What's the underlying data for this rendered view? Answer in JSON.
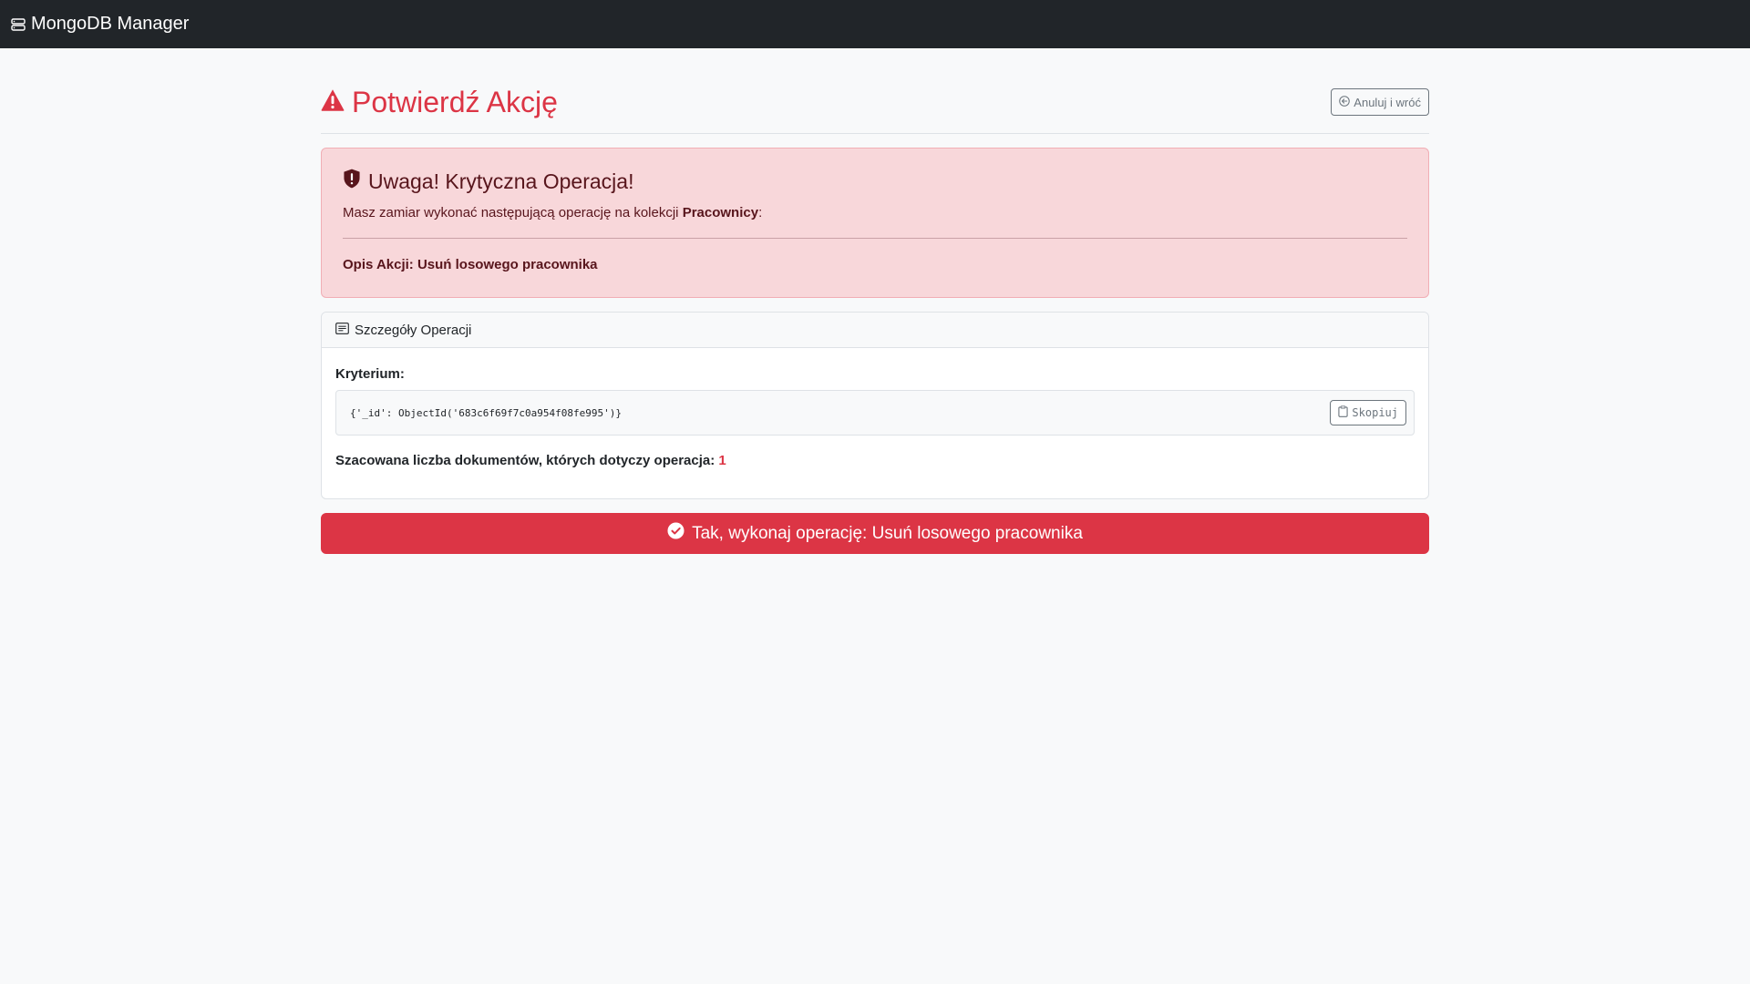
{
  "navbar": {
    "brand_icon": "server-icon",
    "brand_label": "MongoDB Manager"
  },
  "header": {
    "title_icon": "warning-triangle-icon",
    "title": "Potwierdź Akcję",
    "cancel_icon": "arrow-left-circle-icon",
    "cancel_label": "Anuluj i wróć"
  },
  "alert": {
    "icon": "shield-exclamation-icon",
    "heading": "Uwaga! Krytyczna Operacja!",
    "text_prefix": "Masz zamiar wykonać następującą operację na kolekcji ",
    "collection": "Pracownicy",
    "text_suffix": ":",
    "description": "Opis Akcji: Usuń losowego pracownika"
  },
  "details": {
    "header_icon": "card-text-icon",
    "header": "Szczegóły Operacji",
    "criterion_label": "Kryterium:",
    "criterion_value": "{'_id': ObjectId('683c6f69f7c0a954f08fe995')}",
    "copy_icon": "clipboard-icon",
    "copy_label": "Skopiuj",
    "count_label": "Szacowana liczba dokumentów, których dotyczy operacja: ",
    "count_value": "1"
  },
  "confirm": {
    "icon": "check-circle-icon",
    "label": "Tak, wykonaj operację: Usuń losowego pracownika"
  },
  "colors": {
    "danger": "#dc3545",
    "navbar": "#212529",
    "alert_bg": "#f8d7da",
    "secondary": "#6c757d"
  }
}
